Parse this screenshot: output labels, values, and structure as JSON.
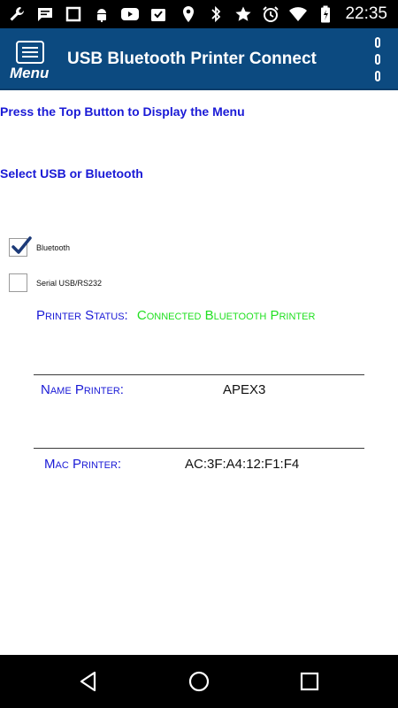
{
  "status_bar": {
    "time": "22:35",
    "left_icons": [
      "wrench-icon",
      "chat-icon",
      "square-icon",
      "android-icon",
      "youtube-icon",
      "download-icon"
    ],
    "right_icons": [
      "location-icon",
      "bluetooth-icon",
      "star-icon",
      "alarm-icon",
      "wifi-icon",
      "battery-icon"
    ]
  },
  "app_bar": {
    "menu_label": "Menu",
    "title": "USB Bluetooth Printer Connect",
    "background": "#0c4a80"
  },
  "content": {
    "hint_menu": "Press the Top Button to Display the Menu",
    "hint_select": "Select USB or Bluetooth",
    "options": [
      {
        "label": "Bluetooth",
        "checked": true
      },
      {
        "label": "Serial USB/RS232",
        "checked": false
      }
    ],
    "printer_status_label": "Printer Status:",
    "printer_status_value": "Connected Bluetooth Printer",
    "name_printer_label": "Name Printer:",
    "name_printer_value": "APEX3",
    "mac_printer_label": "Mac Printer:",
    "mac_printer_value": "AC:3F:A4:12:F1:F4",
    "colors": {
      "accent_blue": "#1a1ad6",
      "status_green": "#22e022"
    }
  },
  "nav_bar": {
    "buttons": [
      "back-icon",
      "home-icon",
      "recents-icon"
    ]
  }
}
